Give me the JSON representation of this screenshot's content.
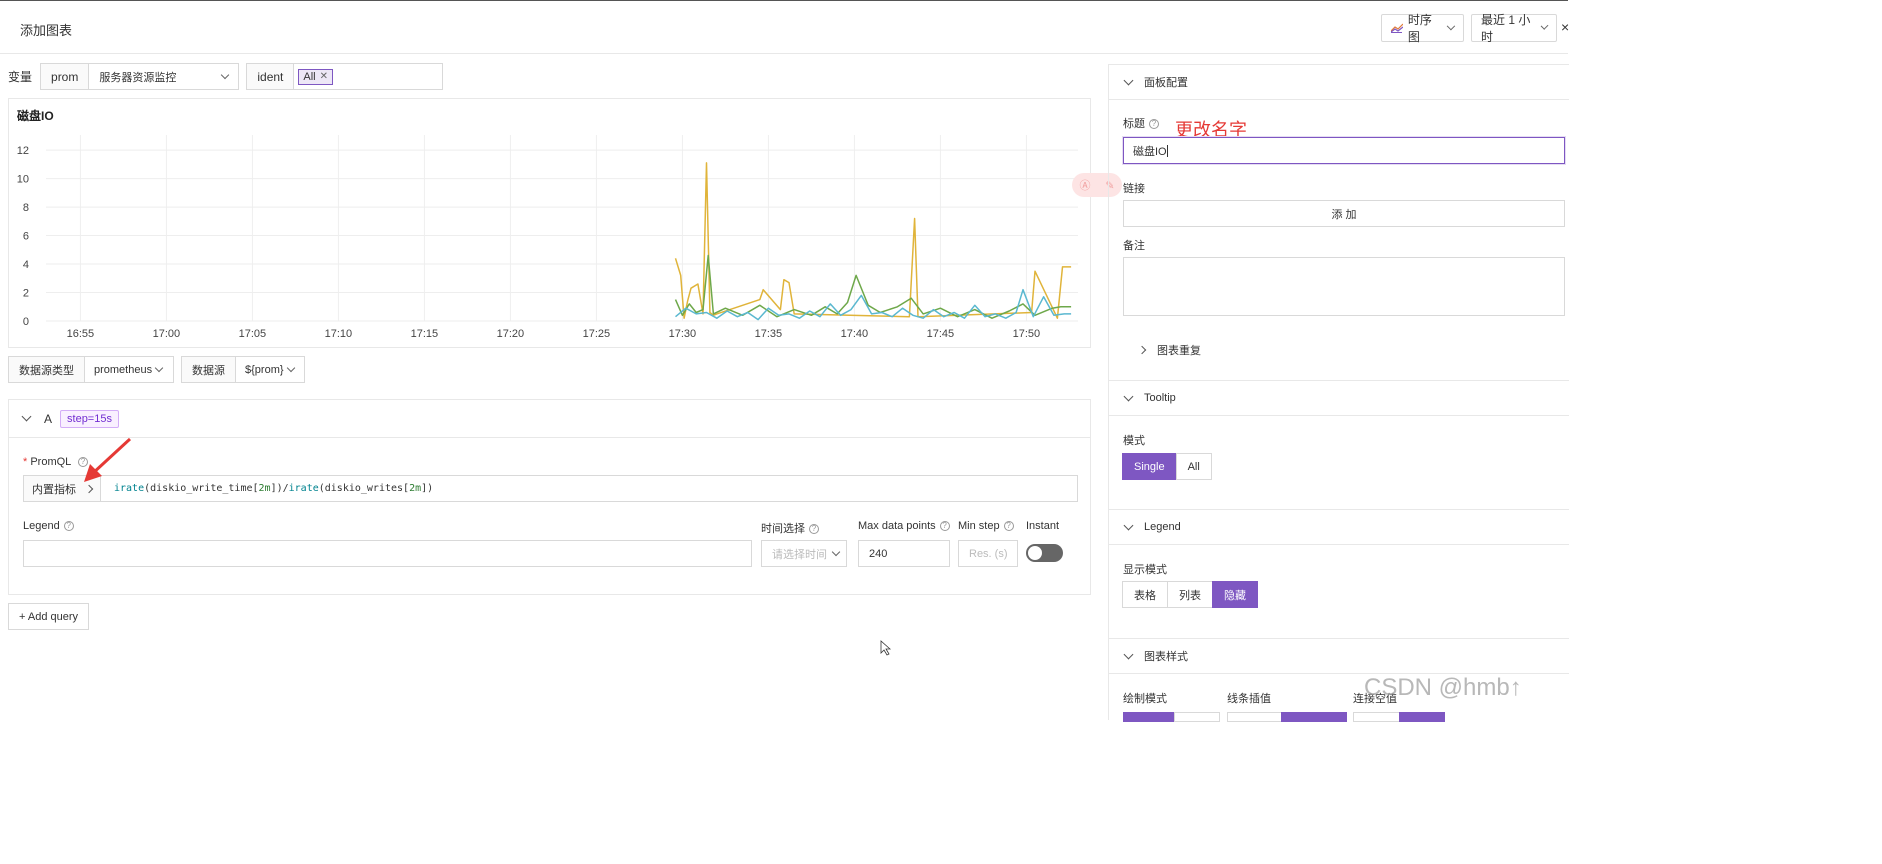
{
  "header": {
    "title": "添加图表",
    "chart_type": "时序图",
    "time_range": "最近 1 小时",
    "close": "×"
  },
  "variables": {
    "label": "变量",
    "prom_label": "prom",
    "prom_value": "服务器资源监控",
    "ident_label": "ident",
    "ident_tag": "All"
  },
  "chart": {
    "title": "磁盘IO"
  },
  "chart_data": {
    "type": "line",
    "title": "磁盘IO",
    "xlabel": "",
    "ylabel": "",
    "ylim": [
      0,
      12.5
    ],
    "yticks": [
      "12",
      "10",
      "8",
      "6",
      "4",
      "2",
      "0"
    ],
    "xticks": [
      "16:55",
      "17:00",
      "17:05",
      "17:10",
      "17:15",
      "17:20",
      "17:25",
      "17:30",
      "17:35",
      "17:40",
      "17:45",
      "17:50"
    ],
    "x_start": "16:53",
    "x_end": "17:53",
    "grid": true,
    "series": [
      {
        "color": "#e0b43a",
        "x": [
          "17:29.6",
          "17:29.9",
          "17:30.1",
          "17:30.3",
          "17:30.5",
          "17:30.9",
          "17:31.2",
          "17:31.4",
          "17:31.6",
          "17:31.8",
          "17:32.0",
          "17:34.5",
          "17:34.7",
          "17:35.7",
          "17:35.9",
          "17:36.2",
          "17:36.5",
          "17:43.2",
          "17:43.5",
          "17:43.7",
          "17:50.3",
          "17:50.5",
          "17:51.8",
          "17:52.1",
          "17:52.6"
        ],
        "values": [
          4.4,
          3.2,
          0.2,
          1.4,
          2.3,
          2.6,
          0.5,
          11.1,
          0.6,
          0.4,
          0.5,
          1.5,
          2.2,
          0.8,
          2.9,
          2.7,
          0.5,
          0.3,
          7.2,
          0.3,
          0.6,
          3.5,
          0.2,
          3.8,
          3.8
        ]
      },
      {
        "color": "#6ea84a",
        "x": [
          "17:29.6",
          "17:30.0",
          "17:30.4",
          "17:30.8",
          "17:31.2",
          "17:31.5",
          "17:31.8",
          "17:32.5",
          "17:33.5",
          "17:34.5",
          "17:35.5",
          "17:36.5",
          "17:37.5",
          "17:38.3",
          "17:39.0",
          "17:39.6",
          "17:40.1",
          "17:40.8",
          "17:41.5",
          "17:42.5",
          "17:43.3",
          "17:44.0",
          "17:45.0",
          "17:46.0",
          "17:47.0",
          "17:48.0",
          "17:49.0",
          "17:49.8",
          "17:50.5",
          "17:51.5",
          "17:52.0",
          "17:52.6"
        ],
        "values": [
          1.5,
          0.4,
          1.2,
          0.6,
          0.8,
          4.6,
          0.5,
          0.9,
          0.4,
          1.1,
          0.3,
          0.8,
          0.4,
          1.0,
          0.5,
          1.3,
          3.2,
          1.1,
          0.6,
          1.0,
          1.6,
          0.5,
          0.9,
          0.3,
          0.8,
          0.2,
          0.7,
          1.2,
          0.4,
          0.9,
          1.0,
          1.0
        ]
      },
      {
        "color": "#5ab8d0",
        "x": [
          "17:29.6",
          "17:30.2",
          "17:30.8",
          "17:31.4",
          "17:32.0",
          "17:32.6",
          "17:33.2",
          "17:33.8",
          "17:34.4",
          "17:35.0",
          "17:35.6",
          "17:36.2",
          "17:36.8",
          "17:37.4",
          "17:38.0",
          "17:38.6",
          "17:39.2",
          "17:39.8",
          "17:40.4",
          "17:41.0",
          "17:41.6",
          "17:42.2",
          "17:42.8",
          "17:43.4",
          "17:44.0",
          "17:44.6",
          "17:45.2",
          "17:45.8",
          "17:46.4",
          "17:47.0",
          "17:47.6",
          "17:48.2",
          "17:48.8",
          "17:49.4",
          "17:49.8",
          "17:50.4",
          "17:51.0",
          "17:51.6",
          "17:52.2",
          "17:52.6"
        ],
        "values": [
          0.3,
          0.9,
          0.5,
          0.6,
          0.2,
          0.7,
          0.3,
          0.6,
          0.1,
          0.9,
          0.4,
          0.5,
          0.2,
          0.7,
          0.3,
          1.2,
          0.4,
          0.8,
          1.8,
          0.5,
          0.6,
          0.3,
          0.9,
          0.4,
          0.2,
          0.8,
          0.3,
          0.6,
          0.2,
          1.1,
          0.3,
          0.5,
          0.2,
          0.6,
          2.2,
          0.3,
          1.7,
          0.4,
          0.5,
          0.5
        ]
      }
    ]
  },
  "datasource": {
    "type_label": "数据源类型",
    "type_value": "prometheus",
    "source_label": "数据源",
    "source_value": "${prom}"
  },
  "query": {
    "name": "A",
    "step_tag": "step=15s",
    "promql_required": "*",
    "promql_label": "PromQL",
    "builtin_metrics": "内置指标",
    "promql_expr": "irate(diskio_write_time[2m])/irate(diskio_writes[2m])",
    "legend_label": "Legend",
    "legend_value": "",
    "time_select_label": "时间选择",
    "time_select_placeholder": "请选择时间",
    "max_points_label": "Max data points",
    "max_points_value": "240",
    "min_step_label": "Min step",
    "min_step_placeholder": "Res. (s)",
    "instant_label": "Instant",
    "instant_on": false
  },
  "add_query": "+ Add query",
  "panel": {
    "section_title": "面板配置",
    "title_label": "标题",
    "annotation": "更改名字",
    "title_value": "磁盘IO",
    "link_label": "链接",
    "add_button": "添 加",
    "note_label": "备注",
    "repeat_label": "图表重复"
  },
  "tooltip": {
    "section_title": "Tooltip",
    "mode_label": "模式",
    "options": [
      "Single",
      "All"
    ],
    "selected": "Single"
  },
  "legend": {
    "section_title": "Legend",
    "display_label": "显示模式",
    "options": [
      "表格",
      "列表",
      "隐藏"
    ],
    "selected": "隐藏"
  },
  "style": {
    "section_title": "图表样式",
    "draw_mode_label": "绘制模式",
    "line_interp_label": "线条插值",
    "connect_null_label": "连接空值"
  },
  "watermark": "CSDN @hmb↑",
  "colors": {
    "accent": "#7e57c2",
    "annotation": "#e53935",
    "series_yellow": "#e0b43a",
    "series_green": "#6ea84a",
    "series_cyan": "#5ab8d0"
  }
}
